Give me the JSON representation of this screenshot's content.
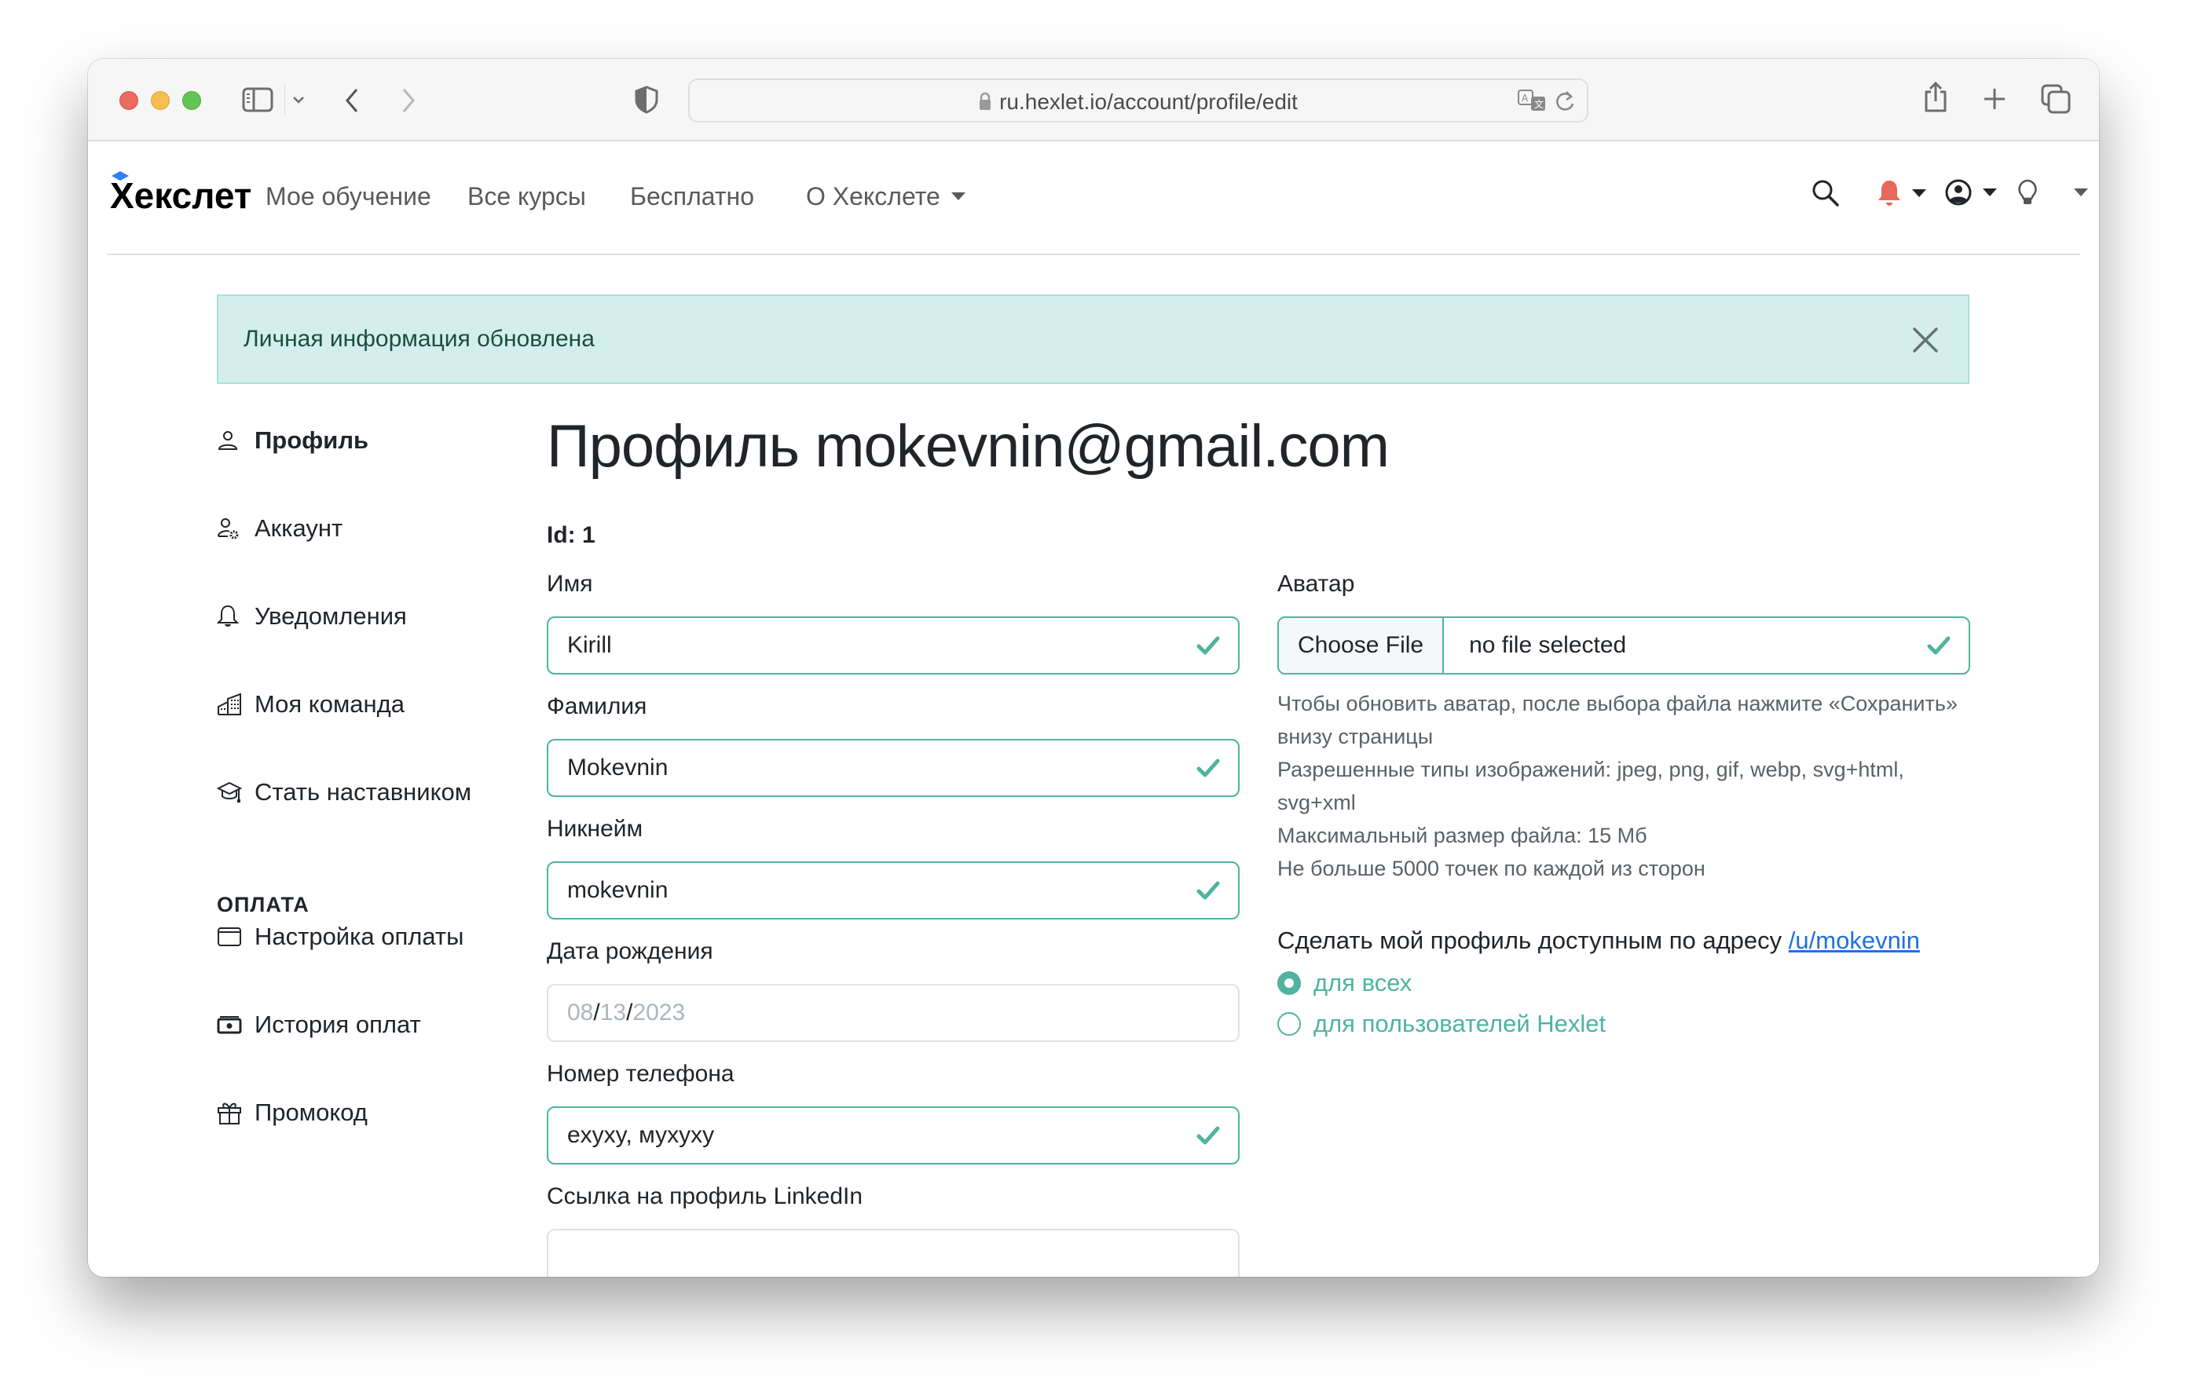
{
  "browser": {
    "url": "ru.hexlet.io/account/profile/edit",
    "icons": [
      "sidebar-toggle-icon",
      "chevron-down-icon",
      "back-icon",
      "forward-icon",
      "shield-icon",
      "lock-icon",
      "translate-icon",
      "reload-icon",
      "share-icon",
      "new-tab-icon",
      "tabs-overview-icon"
    ]
  },
  "header": {
    "logo": "Хекслет",
    "nav": [
      {
        "label": "Мое обучение"
      },
      {
        "label": "Все курсы"
      },
      {
        "label": "Бесплатно"
      },
      {
        "label": "О Хекслете",
        "dropdown": true
      }
    ],
    "icons": [
      "search-icon",
      "bell-icon",
      "user-circle-icon",
      "lightbulb-icon"
    ],
    "bell_color": "#e8695a"
  },
  "alert": {
    "message": "Личная информация обновлена",
    "bg_color": "#d4efeb"
  },
  "sidebar": {
    "items": [
      {
        "label": "Профиль",
        "icon": "person-icon",
        "active": true
      },
      {
        "label": "Аккаунт",
        "icon": "person-gear-icon"
      },
      {
        "label": "Уведомления",
        "icon": "bell-icon"
      },
      {
        "label": "Моя команда",
        "icon": "buildings-icon"
      },
      {
        "label": "Стать наставником",
        "icon": "mortarboard-icon"
      }
    ],
    "payment_heading": "ОПЛАТА",
    "payment_items": [
      {
        "label": "Настройка оплаты",
        "icon": "card-icon"
      },
      {
        "label": "История оплат",
        "icon": "cash-icon"
      },
      {
        "label": "Промокод",
        "icon": "gift-icon"
      }
    ]
  },
  "main": {
    "title": "Профиль mokevnin@gmail.com",
    "id_line": "Id: 1",
    "fields": {
      "first_name": {
        "label": "Имя",
        "value": "Kirill"
      },
      "last_name": {
        "label": "Фамилия",
        "value": "Mokevnin"
      },
      "nickname": {
        "label": "Никнейм",
        "value": "mokevnin"
      },
      "birthdate": {
        "label": "Дата рождения",
        "month": "08",
        "day": "13",
        "year": "2023",
        "sep": "/"
      },
      "phone": {
        "label": "Номер телефона",
        "value": "exyxy, мухуху"
      },
      "linkedin": {
        "label": "Ссылка на профиль LinkedIn",
        "value": ""
      }
    },
    "avatar": {
      "label": "Аватар",
      "button": "Choose File",
      "file_name": "no file selected",
      "help": [
        "Чтобы обновить аватар, после выбора файла нажмите «Сохранить» внизу страницы",
        "Разрешенные типы изображений: jpeg, png, gif, webp, svg+html, svg+xml",
        "Максимальный размер файла: 15 Мб",
        "Не больше 5000 точек по каждой из сторон"
      ]
    },
    "visibility": {
      "label": "Сделать мой профиль доступным по адресу",
      "link": "/u/mokevnin",
      "options": [
        {
          "label": "для всех",
          "checked": true
        },
        {
          "label": "для пользователей Hexlet",
          "checked": false
        }
      ]
    },
    "accent_color": "#4fb39f"
  }
}
